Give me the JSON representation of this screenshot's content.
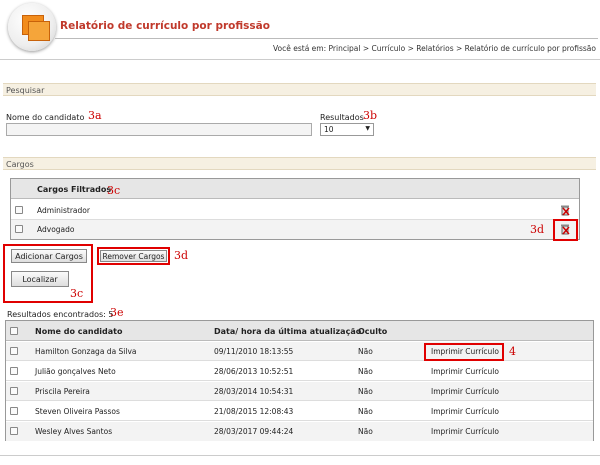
{
  "header": {
    "title": "Relatório de currículo por profissão",
    "breadcrumb": "Você está em: Principal > Currículo > Relatórios > Relatório de currículo por profissão"
  },
  "search": {
    "section": "Pesquisar",
    "name_label": "Nome do candidato",
    "name_value": "",
    "results_label": "Resultados",
    "results_value": "10"
  },
  "cargos": {
    "section": "Cargos",
    "table_header": "Cargos Filtrados",
    "items": [
      "Administrador",
      "Advogado"
    ],
    "add_button": "Adicionar Cargos",
    "remove_button": "Remover Cargos",
    "find_button": "Localizar"
  },
  "results": {
    "count_label": "Resultados encontrados:",
    "count": "5",
    "columns": [
      "Nome do candidato",
      "Data/ hora da última atualização",
      "Oculto"
    ],
    "print_label": "Imprimir Currículo",
    "rows": [
      {
        "name": "Hamilton Gonzaga da Silva",
        "date": "09/11/2010 18:13:55",
        "hidden": "Não"
      },
      {
        "name": "Julião gonçalves Neto",
        "date": "28/06/2013 10:52:51",
        "hidden": "Não"
      },
      {
        "name": "Priscila Pereira",
        "date": "28/03/2014 10:54:31",
        "hidden": "Não"
      },
      {
        "name": "Steven Oliveira Passos",
        "date": "21/08/2015 12:08:43",
        "hidden": "Não"
      },
      {
        "name": "Wesley Alves Santos",
        "date": "28/03/2017 09:44:24",
        "hidden": "Não"
      }
    ]
  },
  "annotations": {
    "a3a": "3a",
    "a3b": "3b",
    "a3c_header": "3c",
    "a3d_trash": "3d",
    "a3d_button": "3d",
    "a3c_buttons": "3c",
    "a3e": "3e",
    "a4": "4"
  },
  "colors": {
    "title": "#c0392b",
    "annotation": "#e00000",
    "section_bg": "#f6f0e2"
  }
}
